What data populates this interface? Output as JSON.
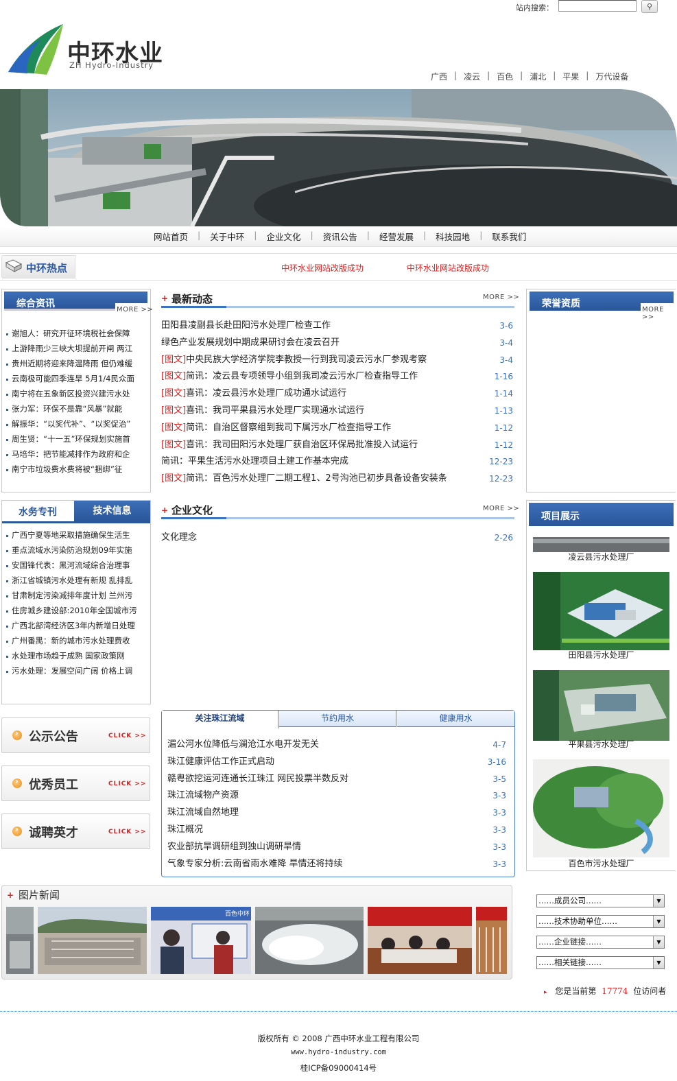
{
  "search": {
    "label": "站内搜索：",
    "button_icon": "search-icon"
  },
  "logo": {
    "cn": "中环水业",
    "en": "ZH Hydro-Industry"
  },
  "region_nav": [
    "广西",
    "凌云",
    "百色",
    "浦北",
    "平果",
    "万代设备"
  ],
  "main_nav": [
    "网站首页",
    "关于中环",
    "企业文化",
    "资讯公告",
    "经营发展",
    "科技园地",
    "联系我们"
  ],
  "hot": {
    "title": "中环热点",
    "items": [
      "中环水业网站改版成功",
      "中环水业网站改版成功"
    ]
  },
  "general": {
    "title": "综合资讯",
    "more": "MORE >>",
    "items": [
      "谢旭人：研究开征环境税社会保障",
      "上游降雨少三峡大坝提前开闸 两江",
      "贵州近期将迎来降温降雨 但仍难缓",
      "云南极可能四季连旱 5月1/4民众面",
      "南宁将在五象新区投资兴建污水处",
      "张力军：环保不是靠“风暴”就能",
      "解振华：“以奖代补”、“以奖促治”",
      "周生贤：“十一五”环保规划实施首",
      "马培华：把节能减排作为政府和企",
      "南宁市垃圾费水费将被“捆绑”征"
    ]
  },
  "water": {
    "tabs": [
      "水务专刊",
      "技术信息"
    ],
    "items": [
      "广西宁夏等地采取措施确保生活生",
      "重点流域水污染防治规划09年实施",
      "安国锋代表：黑河流域综合治理事",
      "浙江省城镇污水处理有新规 乱排乱",
      "甘肃制定污染减排年度计划 兰州污",
      "住房城乡建设部:2010年全国城市污",
      "广西北部湾经济区3年内新增日处理",
      "广州番禺：新的城市污水处理费收",
      "水处理市场趋于成熟  国家政策刚",
      "污水处理：发展空间广阔 价格上调"
    ]
  },
  "buttons": [
    {
      "label": "公示公告",
      "click": "CLICK >>"
    },
    {
      "label": "优秀员工",
      "click": "CLICK >>"
    },
    {
      "label": "诚聘英才",
      "click": "CLICK >>"
    }
  ],
  "latest": {
    "title": "最新动态",
    "more": "MORE >>",
    "items": [
      {
        "tag": "",
        "text": "田阳县凌副县长赴田阳污水处理厂检查工作",
        "date": "3-6"
      },
      {
        "tag": "",
        "text": "绿色产业发展规划中期成果研讨会在凌云召开",
        "date": "3-4"
      },
      {
        "tag": "[图文]",
        "text": "中央民族大学经济学院李教授一行到我司凌云污水厂参观考察",
        "date": "3-4"
      },
      {
        "tag": "[图文]",
        "text": "简讯：凌云县专项领导小组到我司凌云污水厂检查指导工作",
        "date": "1-16"
      },
      {
        "tag": "[图文]",
        "text": "喜讯：凌云县污水处理厂成功通水试运行",
        "date": "1-14"
      },
      {
        "tag": "[图文]",
        "text": "喜讯：我司平果县污水处理厂实现通水试运行",
        "date": "1-13"
      },
      {
        "tag": "[图文]",
        "text": "简讯：自治区督察组到我司下属污水厂检查指导工作",
        "date": "1-12"
      },
      {
        "tag": "[图文]",
        "text": "喜讯：我司田阳污水处理厂获自治区环保局批准投入试运行",
        "date": "1-12"
      },
      {
        "tag": "",
        "text": "简讯：平果生活污水处理项目土建工作基本完成",
        "date": "12-23"
      },
      {
        "tag": "[图文]",
        "text": "简讯：百色污水处理厂二期工程1、2号沟池已初步具备设备安装条",
        "date": "12-23"
      }
    ]
  },
  "culture": {
    "title": "企业文化",
    "more": "MORE >>",
    "items": [
      {
        "text": "文化理念",
        "date": "2-26"
      }
    ]
  },
  "zhujiang": {
    "tabs": [
      "关注珠江流域",
      "节约用水",
      "健康用水"
    ],
    "items": [
      {
        "text": "湄公河水位降低与澜沧江水电开发无关",
        "date": "4-7"
      },
      {
        "text": "珠江健康评估工作正式启动",
        "date": "3-16"
      },
      {
        "text": "赣粤欲挖运河连通长江珠江 网民投票半数反对",
        "date": "3-5"
      },
      {
        "text": "珠江流域物产资源",
        "date": "3-3"
      },
      {
        "text": "珠江流域自然地理",
        "date": "3-3"
      },
      {
        "text": "珠江概况",
        "date": "3-3"
      },
      {
        "text": "农业部抗旱调研组到独山调研旱情",
        "date": "3-3"
      },
      {
        "text": "气象专家分析:云南省雨水难降 旱情还将持续",
        "date": "3-3"
      }
    ]
  },
  "pic_news": {
    "title": "图片新闻",
    "sign_text": "百色中环"
  },
  "honor": {
    "title": "荣誉资质",
    "more": "MORE >>"
  },
  "projects": {
    "title": "项目展示",
    "items": [
      "凌云县污水处理厂",
      "田阳县污水处理厂",
      "平果县污水处理厂",
      "百色市污水处理厂"
    ]
  },
  "selects": [
    "……成员公司……",
    "……技术协助单位……",
    "……企业链接……",
    "……相关链接……"
  ],
  "visitor": {
    "prefix": "您是当前第",
    "count": "17774",
    "suffix": "位访问者"
  },
  "footer": {
    "copyright": "版权所有 © 2008 广西中环水业工程有限公司",
    "url": "www.hydro-industry.com",
    "icp": "桂ICP备09000414号"
  },
  "colors": {
    "brand_blue": "#2a569a",
    "accent_red": "#d82020",
    "date_blue": "#3a70c0"
  }
}
